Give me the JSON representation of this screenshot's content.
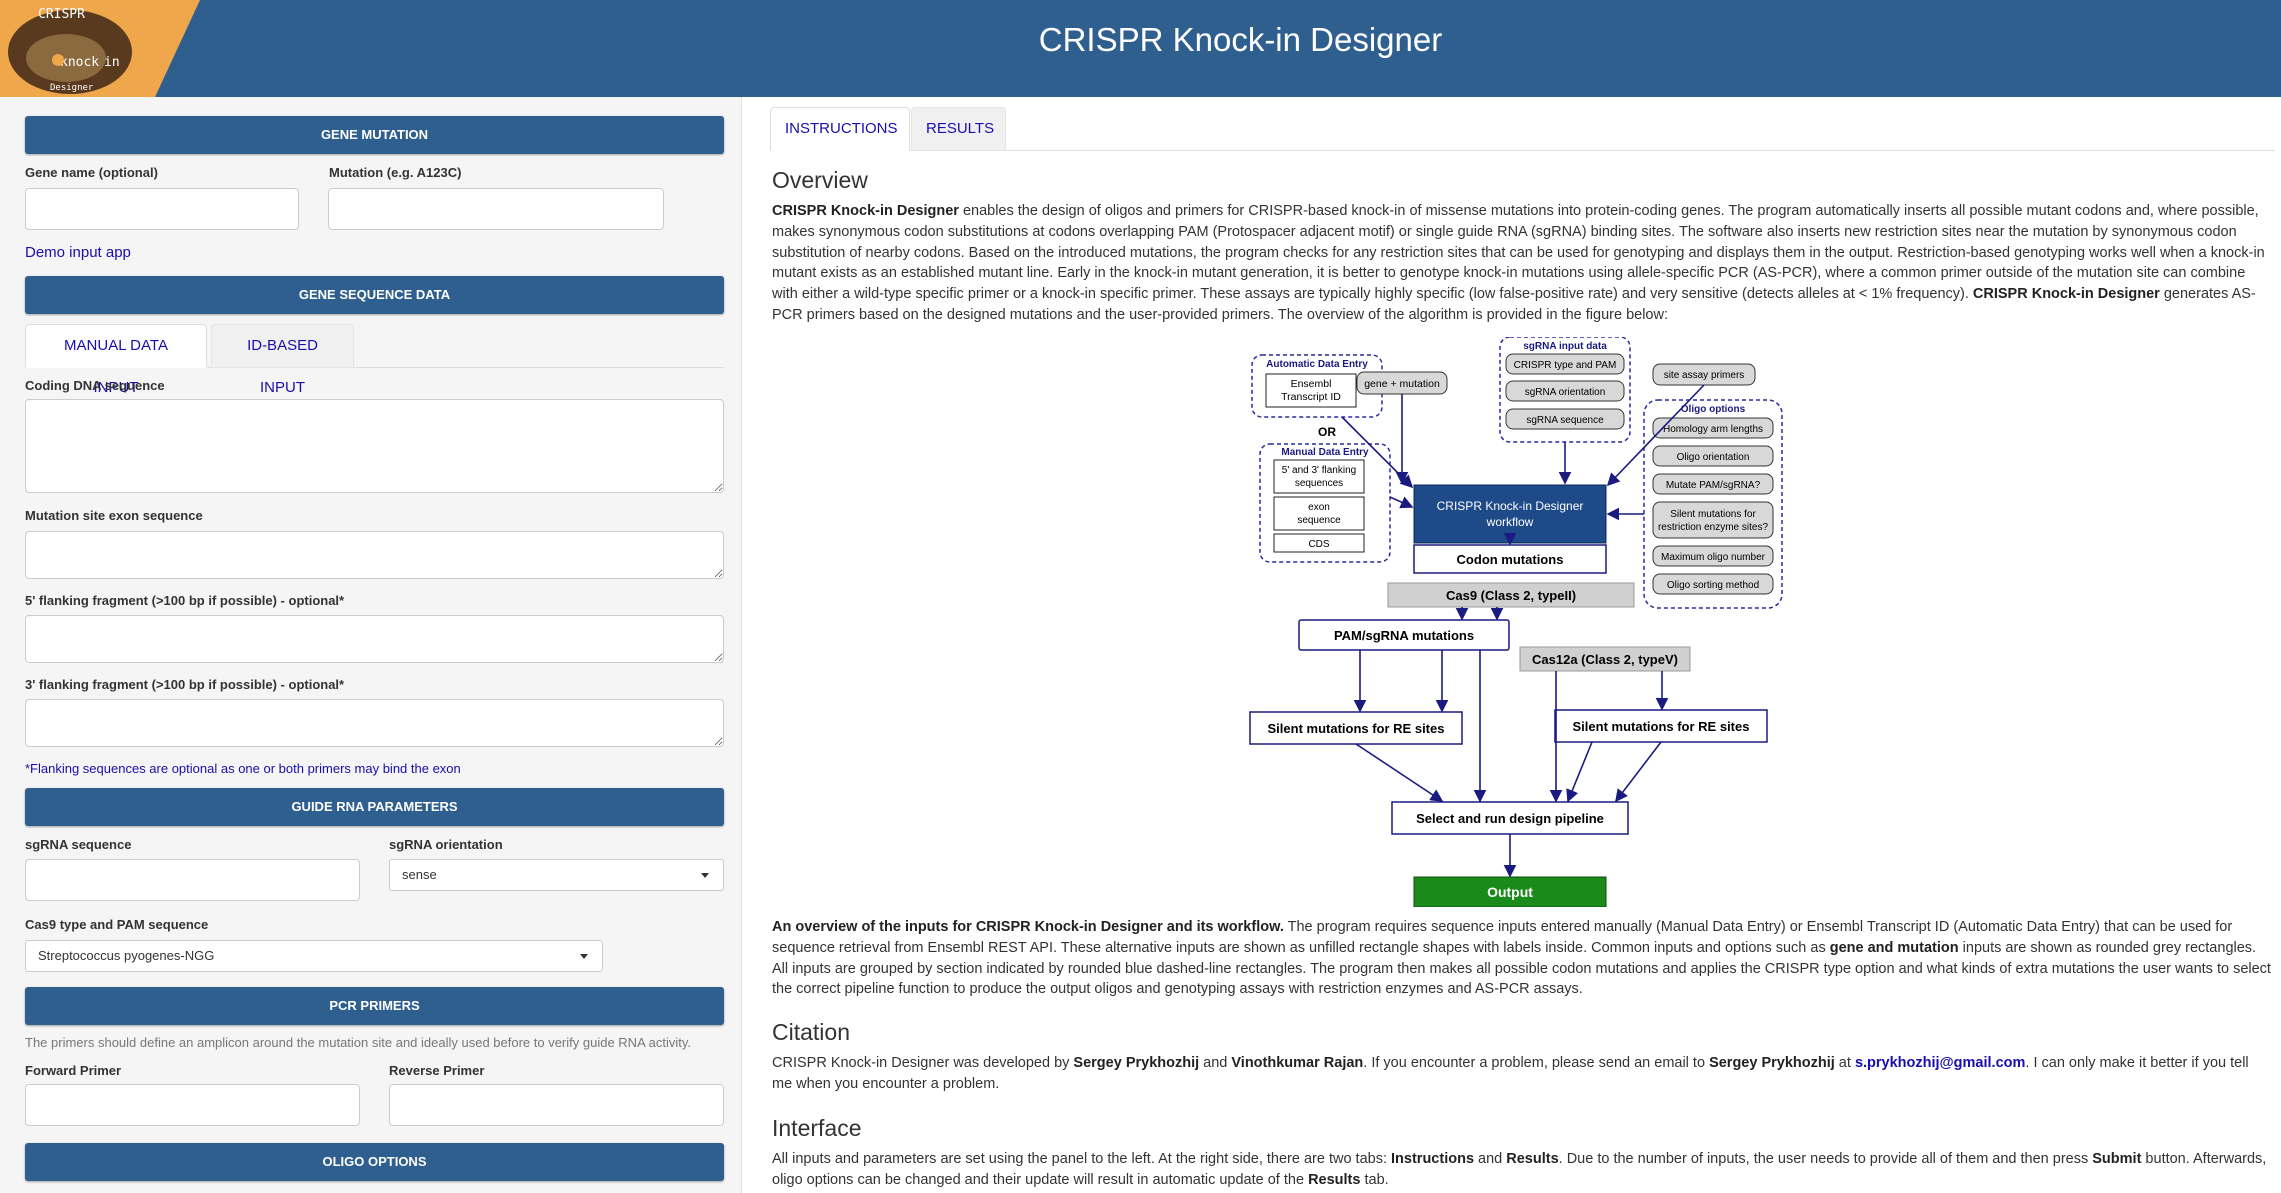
{
  "header": {
    "title": "CRISPR Knock-in Designer",
    "logo_text": [
      "CRISPR",
      "knock",
      "in",
      "Designer"
    ]
  },
  "sidebar": {
    "gene_mutation_header": "GENE MUTATION",
    "gene_name_label": "Gene name (optional)",
    "gene_name_value": "",
    "mutation_label": "Mutation (e.g. A123C)",
    "mutation_value": "",
    "demo_link": "Demo input app",
    "gene_sequence_header": "GENE SEQUENCE DATA",
    "tabs": [
      "MANUAL DATA INPUT",
      "ID-BASED INPUT"
    ],
    "coding_dna_label": "Coding DNA sequence",
    "coding_dna_value": "",
    "exon_label": "Mutation site exon sequence",
    "exon_value": "",
    "flank5_label": "5' flanking fragment (>100 bp if possible) - optional*",
    "flank5_value": "",
    "flank3_label": "3' flanking fragment (>100 bp if possible) - optional*",
    "flank3_value": "",
    "flank_note": "*Flanking sequences are optional as one or both primers may bind the exon",
    "guide_rna_header": "GUIDE RNA PARAMETERS",
    "sgrna_seq_label": "sgRNA sequence",
    "sgrna_seq_value": "",
    "sgrna_orient_label": "sgRNA orientation",
    "sgrna_orient_value": "sense",
    "cas9_label": "Cas9 type and PAM sequence",
    "cas9_value": "Streptococcus pyogenes-NGG",
    "pcr_header": "PCR PRIMERS",
    "pcr_note": "The primers should define an amplicon around the mutation site and ideally used before to verify guide RNA activity.",
    "fwd_label": "Forward Primer",
    "fwd_value": "",
    "rev_label": "Reverse Primer",
    "rev_value": "",
    "oligo_header": "OLIGO OPTIONS"
  },
  "main": {
    "tabs": [
      "INSTRUCTIONS",
      "RESULTS"
    ],
    "overview_title": "Overview",
    "overview_bold1": "CRISPR Knock-in Designer",
    "overview_text1": " enables the design of oligos and primers for CRISPR-based knock-in of missense mutations into protein-coding genes. The program automatically inserts all possible mutant codons and, where possible, makes synonymous codon substitutions at codons overlapping PAM (Protospacer adjacent motif) or single guide RNA (sgRNA) binding sites. The software also inserts new restriction sites near the mutation by synonymous codon substitution of nearby codons. Based on the introduced mutations, the program checks for any restriction sites that can be used for genotyping and displays them in the output. Restriction-based genotyping works well when a knock-in mutant exists as an established mutant line. Early in the knock-in mutant generation, it is better to genotype knock-in mutations using allele-specific PCR (AS-PCR), where a common primer outside of the mutation site can combine with either a wild-type specific primer or a knock-in specific primer. These assays are typically highly specific (low false-positive rate) and very sensitive (detects alleles at < 1% frequency). ",
    "overview_bold2": "CRISPR Knock-in Designer",
    "overview_text2": " generates AS-PCR primers based on the designed mutations and the user-provided primers. The overview of the algorithm is provided in the figure below:",
    "caption_bold": "An overview of the inputs for CRISPR Knock-in Designer and its workflow.",
    "caption_text1": " The program requires sequence inputs entered manually (Manual Data Entry) or Ensembl Transcript ID (Automatic Data Entry) that can be used for sequence retrieval from Ensembl REST API. These alternative inputs are shown as unfilled rectangle shapes with labels inside. Common inputs and options such as ",
    "caption_bold2": "gene and mutation",
    "caption_text2": " inputs are shown as rounded grey rectangles. All inputs are grouped by section indicated by rounded blue dashed-line rectangles. The program then makes all possible codon mutations and applies the CRISPR type option and what kinds of extra mutations the user wants to select the correct pipeline function to produce the output oligos and genotyping assays with restriction enzymes and AS-PCR assays.",
    "citation_title": "Citation",
    "citation_t1": "CRISPR Knock-in Designer was developed by ",
    "citation_b1": "Sergey Prykhozhij",
    "citation_t2": " and ",
    "citation_b2": "Vinothkumar Rajan",
    "citation_t3": ". If you encounter a problem, please send an email to ",
    "citation_b3": "Sergey Prykhozhij",
    "citation_t4": " at ",
    "citation_email": "s.prykhozhij@gmail.com",
    "citation_t5": ". I can only make it better if you tell me when you encounter a problem.",
    "interface_title": "Interface",
    "interface_t1": "All inputs and parameters are set using the panel to the left. At the right side, there are two tabs: ",
    "interface_b1": "Instructions",
    "interface_t2": " and ",
    "interface_b2": "Results",
    "interface_t3": ". Due to the number of inputs, the user needs to provide all of them and then press ",
    "interface_b3": "Submit",
    "interface_t4": " button. Afterwards, oligo options can be changed and their update will result in automatic update of the ",
    "interface_b4": "Results",
    "interface_t5": " tab."
  },
  "diagram": {
    "auto_entry": "Automatic Data Entry",
    "ensembl": [
      "Ensembl",
      "Transcript ID"
    ],
    "or": "OR",
    "manual_entry": "Manual Data Entry",
    "flanking": [
      "5' and 3' flanking",
      "sequences"
    ],
    "exon": [
      "exon",
      "sequence"
    ],
    "cds": "CDS",
    "gene_mutation": "gene + mutation",
    "sgrna_input": "sgRNA input data",
    "crispr_type": "CRISPR type and PAM",
    "sgrna_orient": "sgRNA orientation",
    "sgrna_seq": "sgRNA sequence",
    "site_assay": "site assay primers",
    "oligo_options": "Oligo options",
    "homology": "Homology arm lengths",
    "oligo_orient": "Oligo orientation",
    "mutate_pam": "Mutate PAM/sgRNA?",
    "silent_re": [
      "Silent mutations for",
      "restriction enzyme sites?"
    ],
    "max_oligo": "Maximum oligo number",
    "sort_method": "Oligo sorting method",
    "workflow": [
      "CRISPR Knock-in Designer",
      "workflow"
    ],
    "codon_mut": "Codon mutations",
    "cas9": "Cas9 (Class 2, typeII)",
    "pam_sgrna": "PAM/sgRNA mutations",
    "cas12a": "Cas12a (Class 2, typeV)",
    "silent_left": "Silent mutations for RE sites",
    "silent_right": "Silent mutations for RE sites",
    "pipeline": "Select and run design pipeline",
    "output": "Output"
  }
}
